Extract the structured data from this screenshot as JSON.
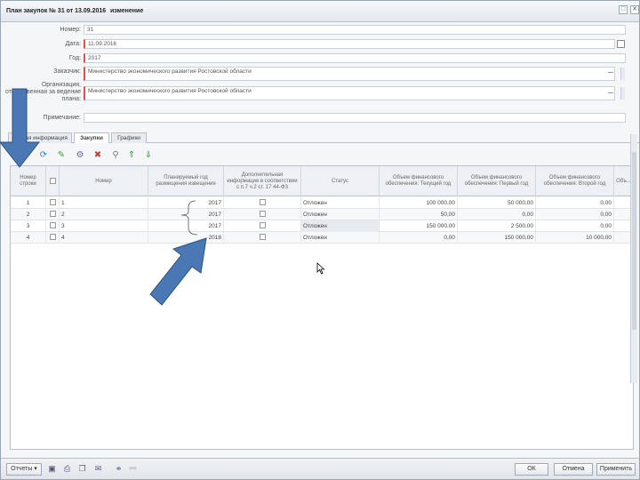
{
  "window": {
    "title": "План закупок № 31 от 13.09.2016",
    "status": "изменение",
    "min_glyph": "□",
    "close_glyph": "✕"
  },
  "form": {
    "number_label": "Номер:",
    "number_value": "31",
    "date_label": "Дата:",
    "date_value": "11.09.2016",
    "year_label": "Год:",
    "year_value": "2017",
    "customer_label": "Заказчик:",
    "customer_value": "Министерство экономического развития Ростовской области",
    "org_label_1": "Организация,",
    "org_label_2": "ответственная за ведение",
    "org_label_3": "плана:",
    "org_value": "Министерство экономического развития Ростовской области",
    "note_label": "Примечание:",
    "note_value": "",
    "dots": "..."
  },
  "tabs": [
    {
      "label": "Общая информация"
    },
    {
      "label": "Закупки"
    },
    {
      "label": "Графики"
    }
  ],
  "toolbar": {
    "icons": [
      "add-icon",
      "refresh-icon",
      "edit-icon",
      "settings-icon",
      "delete-icon",
      "filter-icon",
      "move-up-icon",
      "move-down-icon"
    ]
  },
  "grid": {
    "headers": {
      "row_num": "Номер строки",
      "check": "",
      "num": "Номер",
      "year": "Планируемый год размещения извещения",
      "extra": "Дополнительная информация в соответствии с п.7 ч.2 ст. 17 44-ФЗ",
      "status": "Статус",
      "fin_current": "Объем финансового обеспечения: Текущий год",
      "fin_first": "Объем финансового обеспечения: Первый год",
      "fin_second": "Объем финансового обеспечения: Второй год",
      "last": "Объ..."
    },
    "rows": [
      {
        "row_num": "1",
        "num": "1",
        "year": "2017",
        "status": "Отложен",
        "fin_current": "100 000,00",
        "fin_first": "50 000,00",
        "fin_second": "0,00"
      },
      {
        "row_num": "2",
        "num": "2",
        "year": "2017",
        "status": "Отложен",
        "fin_current": "50,00",
        "fin_first": "0,00",
        "fin_second": "0,00"
      },
      {
        "row_num": "3",
        "num": "3",
        "year": "2017",
        "status": "Отложен",
        "fin_current": "150 000,00",
        "fin_first": "2 500,00",
        "fin_second": "0,00"
      },
      {
        "row_num": "4",
        "num": "4",
        "year": "2018",
        "status": "Отложен",
        "fin_current": "0,00",
        "fin_first": "150 000,00",
        "fin_second": "10 000,00"
      }
    ]
  },
  "bottom": {
    "reports_label": "Отчеты",
    "ok_label": "ОК",
    "cancel_label": "Отмена",
    "apply_label": "Применить"
  },
  "colors": {
    "arrow_fill": "#4a78b5",
    "arrow_stroke": "#2c4f80"
  }
}
